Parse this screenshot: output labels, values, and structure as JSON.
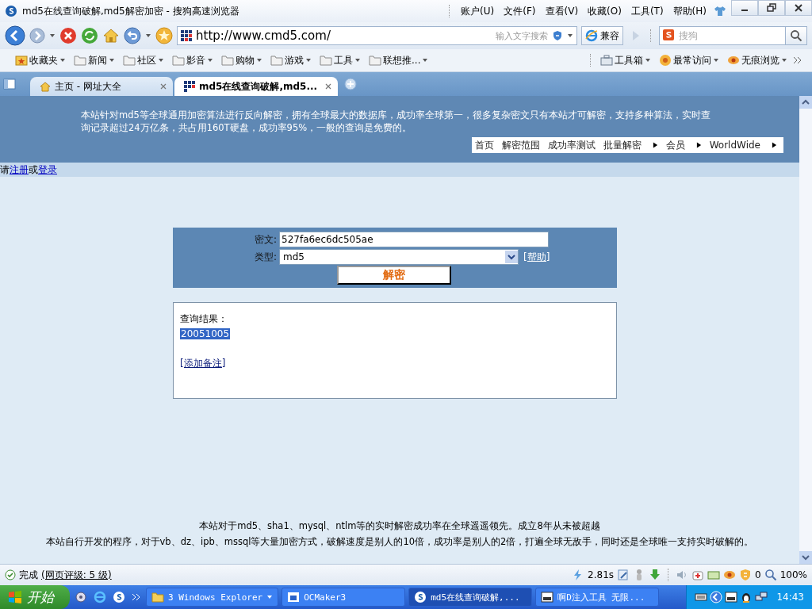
{
  "window": {
    "title": "md5在线查询破解,md5解密加密 - 搜狗高速浏览器"
  },
  "menu": [
    "账户(U)",
    "文件(F)",
    "查看(V)",
    "收藏(O)",
    "工具(T)",
    "帮助(H)"
  ],
  "toolbar": {
    "address": "http://www.cmd5.com/",
    "address_search_placeholder": "输入文字搜索",
    "compat_button": "兼容",
    "search_placeholder": "搜狗"
  },
  "bookmarks": {
    "left": [
      {
        "label": "收藏夹",
        "kind": "favorites"
      },
      {
        "label": "新闻",
        "kind": "folder"
      },
      {
        "label": "社区",
        "kind": "folder"
      },
      {
        "label": "影音",
        "kind": "folder"
      },
      {
        "label": "购物",
        "kind": "folder"
      },
      {
        "label": "游戏",
        "kind": "folder"
      },
      {
        "label": "工具",
        "kind": "folder"
      },
      {
        "label": "联想推...",
        "kind": "folder"
      }
    ],
    "right": [
      {
        "label": "工具箱",
        "kind": "toolbox"
      },
      {
        "label": "最常访问",
        "kind": "frequent"
      },
      {
        "label": "无痕浏览",
        "kind": "private"
      }
    ]
  },
  "tabs": [
    {
      "label": "主页 - 网址大全",
      "selected": false,
      "kind": "home"
    },
    {
      "label": "md5在线查询破解,md5...",
      "selected": true,
      "kind": "site"
    }
  ],
  "page": {
    "intro": "本站针对md5等全球通用加密算法进行反向解密，拥有全球最大的数据库，成功率全球第一，很多复杂密文只有本站才可解密，支持多种算法，实时查询记录超过24万亿条，共占用160T硬盘，成功率95%，一般的查询是免费的。",
    "nav": [
      {
        "label": "首页",
        "arrow": false
      },
      {
        "label": "解密范围",
        "arrow": false
      },
      {
        "label": "成功率测试",
        "arrow": false
      },
      {
        "label": "批量解密",
        "arrow": true
      },
      {
        "label": "会员",
        "arrow": true
      },
      {
        "label": "WorldWide",
        "arrow": true
      }
    ],
    "login": {
      "prefix": "请",
      "register": "注册",
      "or": "或",
      "login": "登录"
    },
    "form": {
      "cipher_label": "密文:",
      "cipher_value": "527fa6ec6dc505ae",
      "type_label": "类型:",
      "type_value": "md5",
      "help_link": "[帮助]",
      "submit": "解密"
    },
    "result": {
      "heading": "查询结果：",
      "value": "20051005",
      "value_selected": true,
      "note_link": "[添加备注]"
    },
    "footer": [
      "本站对于md5、sha1、mysql、ntlm等的实时解密成功率在全球遥遥领先。成立8年从未被超越",
      "本站自行开发的程序，对于vb、dz、ipb、mssql等大量加密方式，破解速度是别人的10倍，成功率是别人的2倍，打遍全球无敌手，同时还是全球唯一支持实时破解的。"
    ]
  },
  "status_bar": {
    "status": "完成",
    "rating": "(网页评级: 5 级)",
    "time": "2.81s",
    "count": "0",
    "zoom": "100%"
  },
  "taskbar": {
    "start": "开始",
    "tasks": [
      {
        "label": "3 Windows Explorer",
        "selected": false,
        "kind": "folder"
      },
      {
        "label": "OCMaker3",
        "selected": false,
        "kind": "app"
      },
      {
        "label": "md5在线查询破解,...",
        "selected": true,
        "kind": "browser"
      },
      {
        "label": "啊D注入工具 无限...",
        "selected": false,
        "kind": "tool"
      }
    ],
    "clock": "14:43"
  }
}
